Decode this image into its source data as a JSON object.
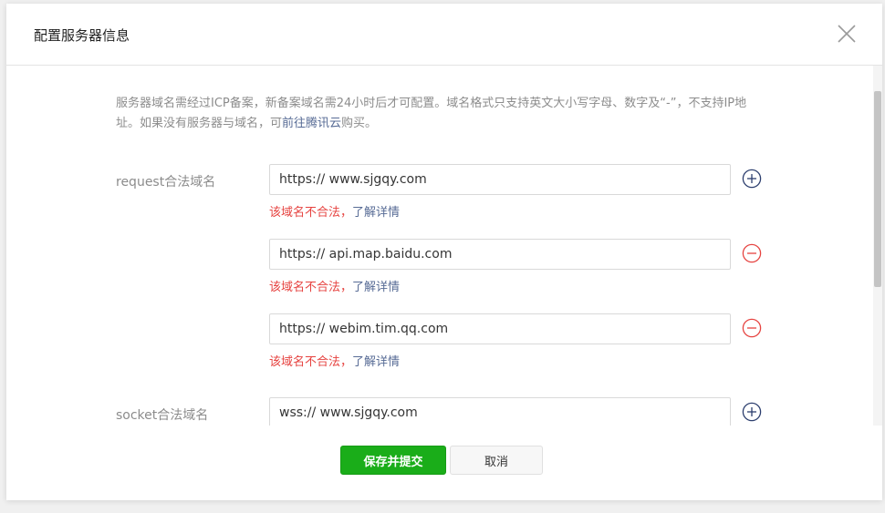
{
  "dialog": {
    "title": "配置服务器信息",
    "note_text": "服务器域名需经过ICP备案，新备案域名需24小时后才可配置。域名格式只支持英文大小写字母、数字及“-”，不支持IP地址。如果没有服务器与域名，可",
    "note_link": "前往腾讯云",
    "note_suffix": "购买。"
  },
  "request": {
    "label": "request合法域名",
    "entries": [
      {
        "value": "https:// www.sjgqy.com",
        "error": "该域名不合法，",
        "error_link": "了解详情",
        "op": "add-icon"
      },
      {
        "value": "https:// api.map.baidu.com",
        "error": "该域名不合法，",
        "error_link": "了解详情",
        "op": "remove-icon"
      },
      {
        "value": "https:// webim.tim.qq.com",
        "error": "该域名不合法，",
        "error_link": "了解详情",
        "op": "remove-icon"
      }
    ]
  },
  "socket": {
    "label": "socket合法域名",
    "entries": [
      {
        "value": "wss:// www.sjgqy.com",
        "op": "add-icon"
      }
    ]
  },
  "footer": {
    "save_label": "保存并提交",
    "cancel_label": "取消"
  },
  "colors": {
    "primary": "#1aad19",
    "error": "#e64340",
    "link": "#576b95",
    "add_icon": "#2c3e6e",
    "remove_icon": "#e64340"
  }
}
